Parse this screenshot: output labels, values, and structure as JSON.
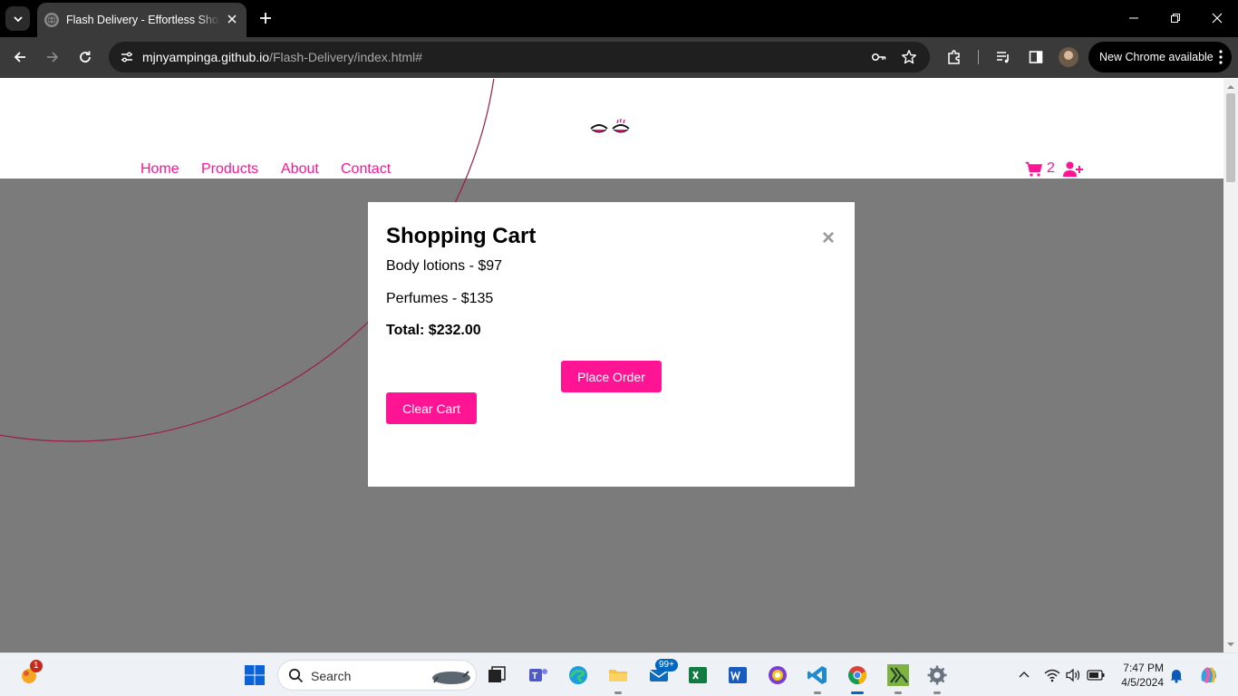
{
  "browser": {
    "tab_title": "Flash Delivery - Effortless Shopping",
    "url_host": "mjnyampinga.github.io",
    "url_path": "/Flash-Delivery/index.html#",
    "update_chip": "New Chrome available"
  },
  "site": {
    "nav": [
      "Home",
      "Products",
      "About",
      "Contact"
    ],
    "cart_count": "2"
  },
  "cart_modal": {
    "title": "Shopping Cart",
    "close_symbol": "×",
    "items": [
      "Body lotions - $97",
      "Perfumes - $135"
    ],
    "total": "Total: $232.00",
    "place_order_label": "Place Order",
    "clear_cart_label": "Clear Cart"
  },
  "colors": {
    "brand_pink": "#ff1493",
    "overlay_gray": "#7b7b7b",
    "arc_crimson": "#9b1c48"
  },
  "taskbar": {
    "search_placeholder": "Search",
    "widgets_badge": "1",
    "mail_badge": "99+",
    "time": "7:47 PM",
    "date": "4/5/2024",
    "pinned": [
      "file-explorer-icon",
      "teams-icon",
      "edge-icon",
      "folder-icon",
      "mail-icon",
      "excel-icon",
      "word-icon",
      "app-icon",
      "vscode-icon",
      "chrome-icon",
      "haskell-icon",
      "settings-icon"
    ]
  }
}
